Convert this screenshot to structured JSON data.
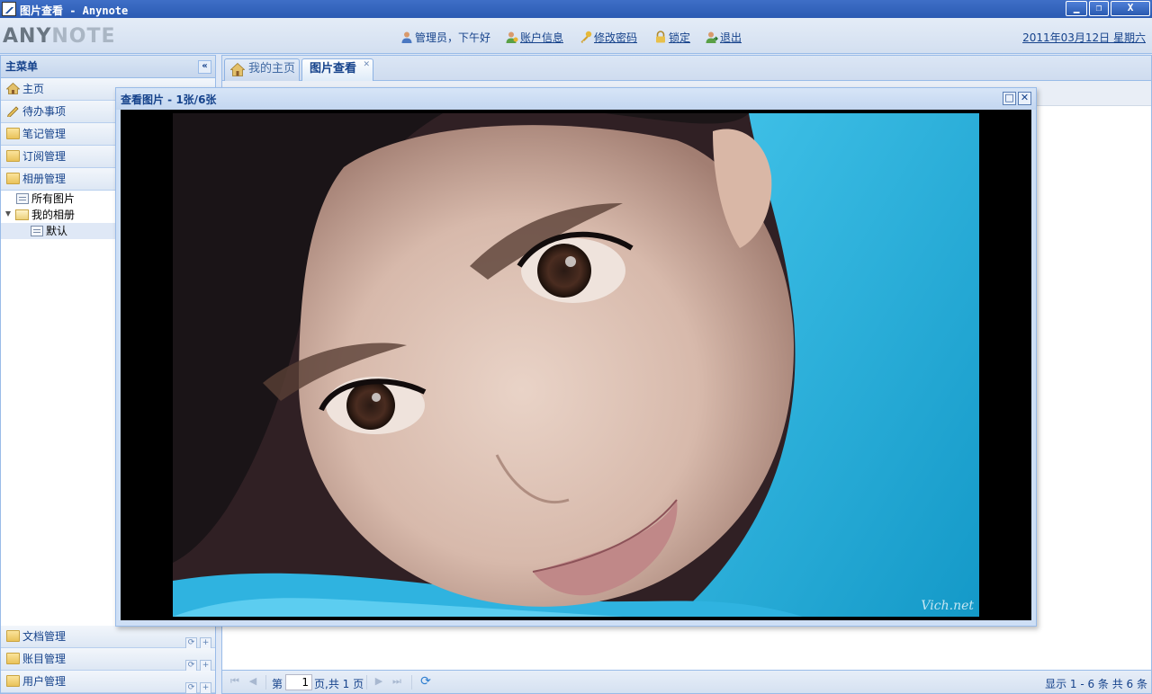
{
  "window": {
    "title": "图片查看 - Anynote",
    "minimize_glyph": "▁",
    "restore_glyph": "❐",
    "close_glyph": "X"
  },
  "header": {
    "logo_first": "ANY",
    "logo_second": "NOTE",
    "links": [
      {
        "label": "管理员，下午好",
        "icon": "user-icon"
      },
      {
        "label": "账户信息",
        "icon": "account-icon"
      },
      {
        "label": "修改密码",
        "icon": "key-icon"
      },
      {
        "label": "锁定",
        "icon": "lock-icon"
      },
      {
        "label": "退出",
        "icon": "logout-icon"
      }
    ],
    "date": "2011年03月12日 星期六"
  },
  "menu": {
    "title": "主菜单",
    "collapse_glyph": "«",
    "top_items": [
      {
        "label": "主页",
        "icon": "home-icon"
      },
      {
        "label": "待办事项",
        "icon": "pencil-icon"
      },
      {
        "label": "笔记管理",
        "icon": "folder-icon"
      },
      {
        "label": "订阅管理",
        "icon": "folder-icon"
      },
      {
        "label": "相册管理",
        "icon": "folder-icon"
      }
    ],
    "tree": [
      {
        "label": "所有图片",
        "icon": "list-icon"
      },
      {
        "label": "我的相册",
        "icon": "folder-icon"
      },
      {
        "label": "默认",
        "icon": "list-icon"
      }
    ],
    "bottom_items": [
      {
        "label": "文档管理",
        "icon": "folder-icon"
      },
      {
        "label": "账目管理",
        "icon": "folder-icon"
      },
      {
        "label": "用户管理",
        "icon": "folder-icon"
      }
    ],
    "tool_refresh": "⟳",
    "tool_add": "+"
  },
  "tabs": [
    {
      "label": "我的主页",
      "active": false
    },
    {
      "label": "图片查看",
      "active": true,
      "close": "✕"
    }
  ],
  "viewer": {
    "title": "查看图片 - 1张/6张",
    "maximize_glyph": "□",
    "close_glyph": "✕",
    "watermark": "Vich.net"
  },
  "pager": {
    "page_prefix": "第",
    "page_value": "1",
    "page_suffix": "页,共 1 页",
    "summary": "显示 1 - 6 条 共 6 条",
    "first": "⏮",
    "prev": "◀",
    "next": "▶",
    "last": "⏭",
    "refresh": "⟳"
  },
  "colors": {
    "title_bar": "#2b5bb3",
    "panel_border": "#99bbe8",
    "text_blue": "#15428b"
  }
}
